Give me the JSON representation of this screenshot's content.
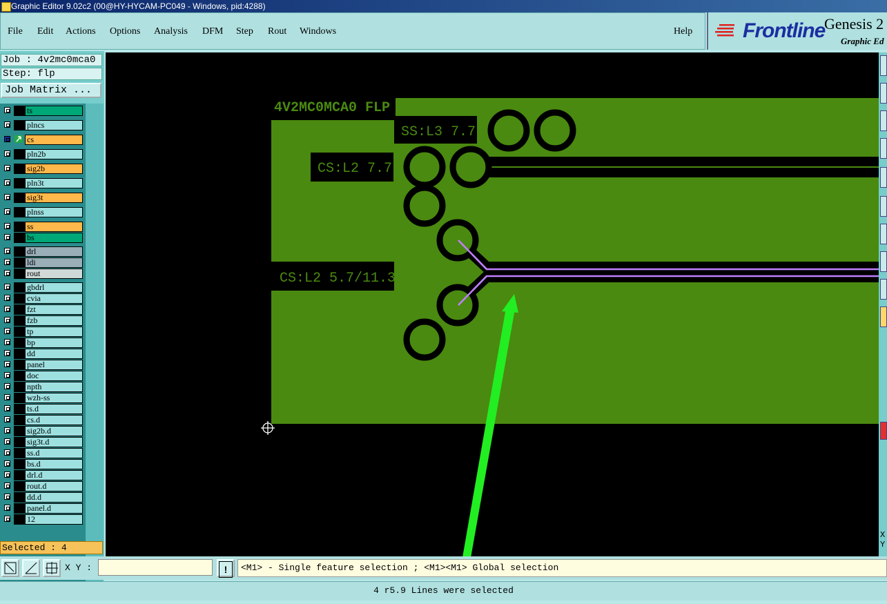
{
  "window": {
    "title": "Graphic Editor 9.02c2 (00@HY-HYCAM-PC049 - Windows, pid:4288)"
  },
  "menu": [
    "File",
    "Edit",
    "Actions",
    "Options",
    "Analysis",
    "DFM",
    "Step",
    "Rout",
    "Windows"
  ],
  "help_label": "Help",
  "logo": {
    "brand": "Frontline",
    "product": "Genesis 2",
    "subtitle": "Graphic Ed"
  },
  "job": {
    "job_label": "Job : 4v2mc0mca0",
    "step_label": "Step: flp",
    "matrix_button": "Job Matrix ..."
  },
  "layers": [
    {
      "name": "ts",
      "color": "#00a878"
    },
    {
      "name": "plncs",
      "color": "#9ee0e0"
    },
    {
      "name": "cs",
      "color": "#ffb84a",
      "active": true
    },
    {
      "name": "pln2b",
      "color": "#9ee0e0"
    },
    {
      "name": "sig2b",
      "color": "#ffb84a"
    },
    {
      "name": "pln3t",
      "color": "#9ee0e0"
    },
    {
      "name": "sig3t",
      "color": "#ffb84a"
    },
    {
      "name": "plnss",
      "color": "#9ee0e0"
    },
    {
      "name": "ss",
      "color": "#ffb84a"
    },
    {
      "name": "bs",
      "color": "#00a878"
    },
    {
      "name": "drl",
      "color": "#9aaeb8"
    },
    {
      "name": "ldi",
      "color": "#9aaeb8"
    },
    {
      "name": "rout",
      "color": "#d0d8d8"
    },
    {
      "name": "gbdrl",
      "color": "#9ee0e0"
    },
    {
      "name": "cvia",
      "color": "#9ee0e0"
    },
    {
      "name": "fzt",
      "color": "#9ee0e0"
    },
    {
      "name": "fzb",
      "color": "#9ee0e0"
    },
    {
      "name": "tp",
      "color": "#9ee0e0"
    },
    {
      "name": "bp",
      "color": "#9ee0e0"
    },
    {
      "name": "dd",
      "color": "#9ee0e0"
    },
    {
      "name": "panel",
      "color": "#9ee0e0"
    },
    {
      "name": "doc",
      "color": "#9ee0e0"
    },
    {
      "name": "npth",
      "color": "#9ee0e0"
    },
    {
      "name": "wzh-ss",
      "color": "#9ee0e0"
    },
    {
      "name": "ts.d",
      "color": "#9ee0e0"
    },
    {
      "name": "cs.d",
      "color": "#9ee0e0"
    },
    {
      "name": "sig2b.d",
      "color": "#9ee0e0"
    },
    {
      "name": "sig3t.d",
      "color": "#9ee0e0"
    },
    {
      "name": "ss.d",
      "color": "#9ee0e0"
    },
    {
      "name": "bs.d",
      "color": "#9ee0e0"
    },
    {
      "name": "drl.d",
      "color": "#9ee0e0"
    },
    {
      "name": "rout.d",
      "color": "#9ee0e0"
    },
    {
      "name": "dd.d",
      "color": "#9ee0e0"
    },
    {
      "name": "panel.d",
      "color": "#9ee0e0"
    },
    {
      "name": "12",
      "color": "#9ee0e0"
    }
  ],
  "selected_label": "Selected : 4",
  "canvas": {
    "board_title": "4V2MC0MCA0 FLP",
    "labels": [
      "SS:L3 7.7",
      "CS:L2 7.7",
      "CS:L2 5.7/11.3"
    ]
  },
  "toolbar": {
    "xy_label": "X Y :",
    "xy_value": "",
    "warn_glyph": "!"
  },
  "hint": "<M1> - Single feature selection ; <M1><M1> Global selection",
  "status": "4 r5.9 Lines were selected",
  "xy_readout": [
    "X",
    "Y"
  ],
  "colors": {
    "board": "#4a8a10",
    "canvas_bg": "#000000",
    "selected_trace": "#c080ff",
    "annotation_arrow": "#22ee22"
  }
}
